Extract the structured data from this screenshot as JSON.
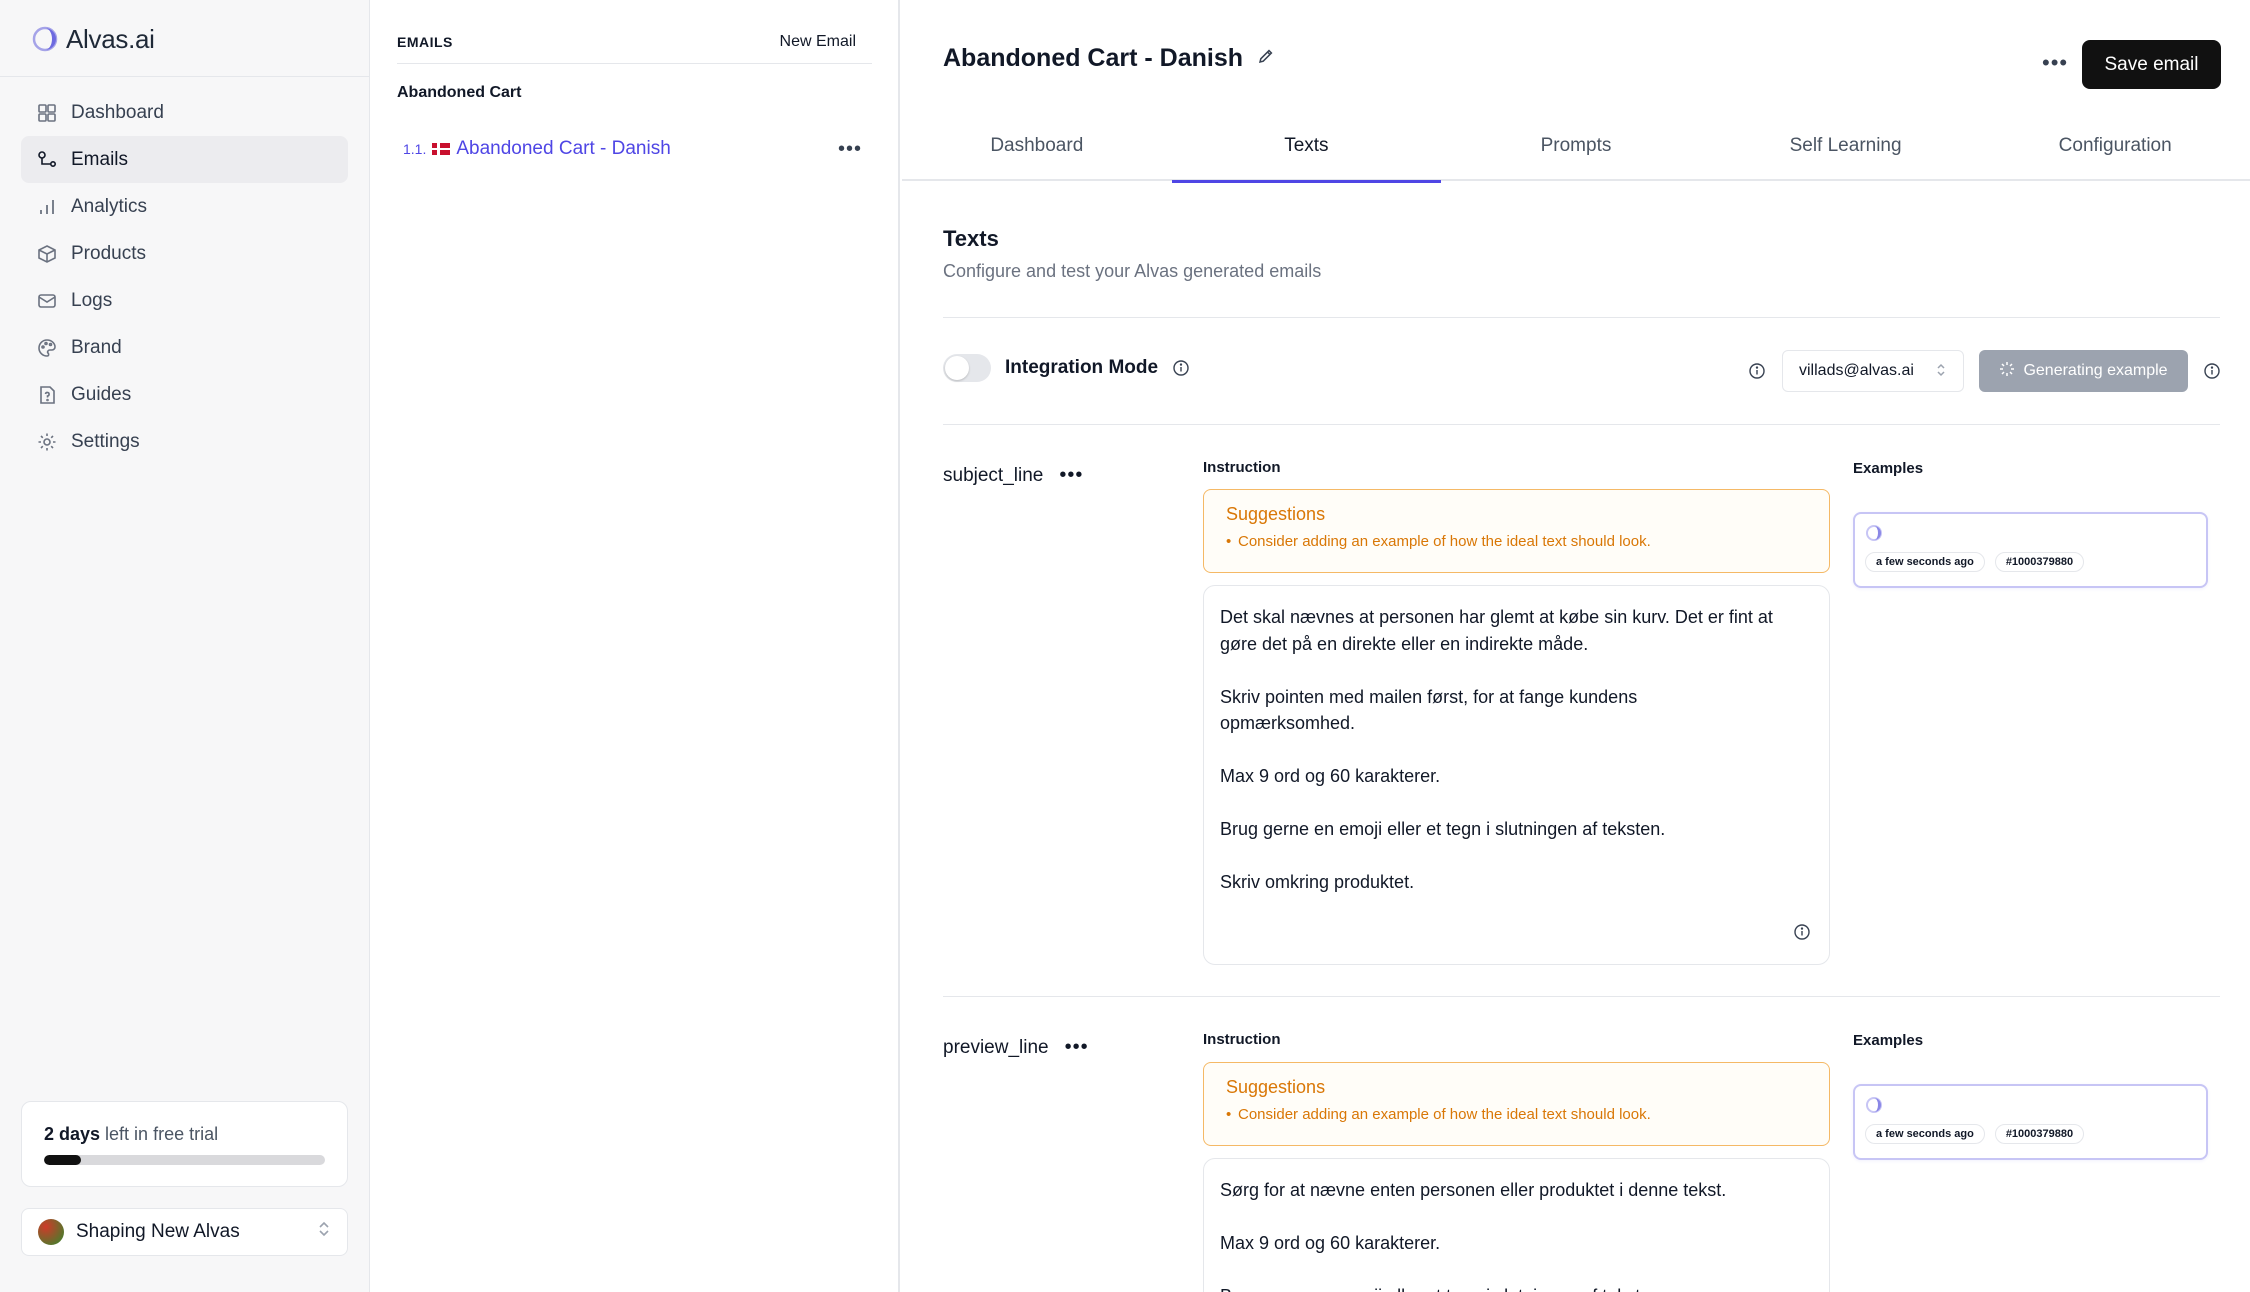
{
  "app": {
    "name": "Alvas.ai"
  },
  "sidebar": {
    "items": [
      {
        "label": "Dashboard",
        "icon": "dashboard-icon",
        "active": false
      },
      {
        "label": "Emails",
        "icon": "emails-icon",
        "active": true
      },
      {
        "label": "Analytics",
        "icon": "analytics-icon",
        "active": false
      },
      {
        "label": "Products",
        "icon": "products-icon",
        "active": false
      },
      {
        "label": "Logs",
        "icon": "logs-icon",
        "active": false
      },
      {
        "label": "Brand",
        "icon": "palette-icon",
        "active": false
      },
      {
        "label": "Guides",
        "icon": "guides-icon",
        "active": false
      },
      {
        "label": "Settings",
        "icon": "gear-icon",
        "active": false
      }
    ],
    "trial": {
      "days": "2 days",
      "rest": " left in free trial",
      "progress": 0.13
    },
    "workspace": {
      "name": "Shaping New Alvas"
    }
  },
  "emails": {
    "header": "EMAILS",
    "new_email": "New Email",
    "group": "Abandoned Cart",
    "items": [
      {
        "number": "1.1.",
        "flag": "dk-flag-icon",
        "name": "Abandoned Cart - Danish"
      }
    ]
  },
  "main": {
    "title": "Abandoned Cart - Danish",
    "save_label": "Save email",
    "tabs": [
      "Dashboard",
      "Texts",
      "Prompts",
      "Self Learning",
      "Configuration"
    ],
    "active_tab": "Texts",
    "section": {
      "title": "Texts",
      "subtitle": "Configure and test your Alvas generated emails"
    },
    "integration_mode": {
      "label": "Integration Mode",
      "enabled": false
    },
    "user_select": {
      "value": "villads@alvas.ai"
    },
    "generate_button": "Generating example",
    "columns": {
      "instruction": "Instruction",
      "examples": "Examples"
    },
    "fields": [
      {
        "name": "subject_line",
        "suggestions_title": "Suggestions",
        "suggestion": "Consider adding an example of how the ideal text should look.",
        "instruction": [
          "Det skal nævnes at personen har glemt at købe sin kurv. Det er fint at",
          "gøre det på en direkte eller en indirekte måde.",
          "",
          "Skriv pointen med mailen først, for at fange kundens",
          "opmærksomhed.",
          "",
          "Max 9 ord og 60 karakterer.",
          "",
          "Brug gerne en emoji eller et tegn i slutningen af teksten.",
          "",
          "Skriv omkring produktet."
        ],
        "example": {
          "time": "a few seconds ago",
          "id": "#1000379880"
        }
      },
      {
        "name": "preview_line",
        "suggestions_title": "Suggestions",
        "suggestion": "Consider adding an example of how the ideal text should look.",
        "instruction": [
          "Sørg for at nævne enten personen eller produktet i denne tekst.",
          "",
          "Max 9 ord og 60 karakterer.",
          "",
          "Brug gerne en emoji eller et tegn i slutningen af teksten."
        ],
        "example": {
          "time": "a few seconds ago",
          "id": "#1000379880"
        }
      }
    ]
  },
  "colors": {
    "accent": "#4f46e5",
    "warning": "#d97706",
    "primary_button": "#111111"
  }
}
